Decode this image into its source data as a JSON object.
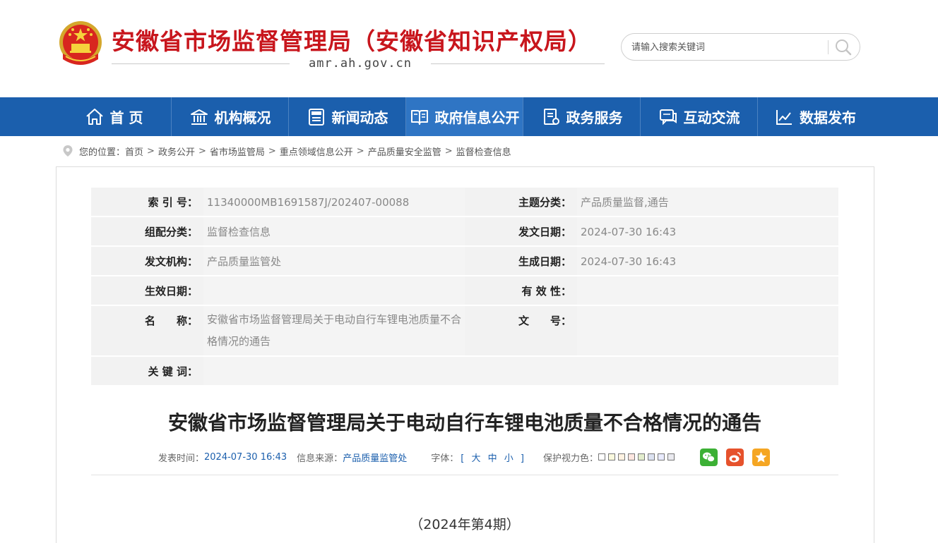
{
  "site": {
    "title": "安徽省市场监督管理局（安徽省知识产权局）",
    "domain": "amr.ah.gov.cn"
  },
  "search": {
    "placeholder": "请输入搜索关键词"
  },
  "nav": {
    "items": [
      {
        "label": "首 页",
        "icon": "home-icon"
      },
      {
        "label": "机构概况",
        "icon": "institution-icon"
      },
      {
        "label": "新闻动态",
        "icon": "news-icon"
      },
      {
        "label": "政府信息公开",
        "icon": "book-icon"
      },
      {
        "label": "政务服务",
        "icon": "document-icon"
      },
      {
        "label": "互动交流",
        "icon": "chat-icon"
      },
      {
        "label": "数据发布",
        "icon": "chart-icon"
      }
    ],
    "active": "政府信息公开"
  },
  "breadcrumb": {
    "prefix": "您的位置：",
    "items": [
      "首页",
      "政务公开",
      "省市场监管局",
      "重点领域信息公开",
      "产品质量安全监管",
      "监督检查信息"
    ],
    "separator": ">"
  },
  "info": {
    "index_no_label": "索 引 号：",
    "index_no": "11340000MB1691587J/202407-00088",
    "topic_label": "主题分类：",
    "topic": "产品质量监督,通告",
    "group_label": "组配分类：",
    "group": "监督检查信息",
    "issue_date_label": "发文日期：",
    "issue_date": "2024-07-30 16:43",
    "agency_label": "发文机构：",
    "agency": "产品质量监管处",
    "created_label": "生成日期：",
    "created": "2024-07-30 16:43",
    "effective_label": "生效日期：",
    "effective": "",
    "validity_label": "有 效 性：",
    "validity": "",
    "name_label": "名　　称：",
    "name": "安徽省市场监督管理局关于电动自行车锂电池质量不合格情况的通告",
    "doc_no_label": "文　　号：",
    "doc_no": "",
    "keywords_label": "关 键 词：",
    "keywords": ""
  },
  "article": {
    "title": "安徽省市场监督管理局关于电动自行车锂电池质量不合格情况的通告",
    "publish_label": "发表时间：",
    "publish_time": "2024-07-30 16:43",
    "source_label": "信息来源：",
    "source": "产品质量监管处",
    "font_label": "字体：",
    "font_open": "[",
    "font_sizes": [
      "大",
      "中",
      "小"
    ],
    "font_close": "]",
    "eye_label": "保护视力色：",
    "eye_colors": [
      "#ffffff",
      "#faf9de",
      "#fff2e2",
      "#fde6e0",
      "#e3edcd",
      "#dce2f1",
      "#e9ebfe",
      "#eaeaef"
    ],
    "issue": "（2024年第4期）"
  },
  "share": {
    "wechat_color": "#3cb035",
    "weibo_color": "#e6522c",
    "favorite_color": "#f5a623"
  },
  "colors": {
    "brand_red": "#c8161d",
    "nav_blue": "#1b5fad",
    "nav_active": "#2f75c4"
  }
}
